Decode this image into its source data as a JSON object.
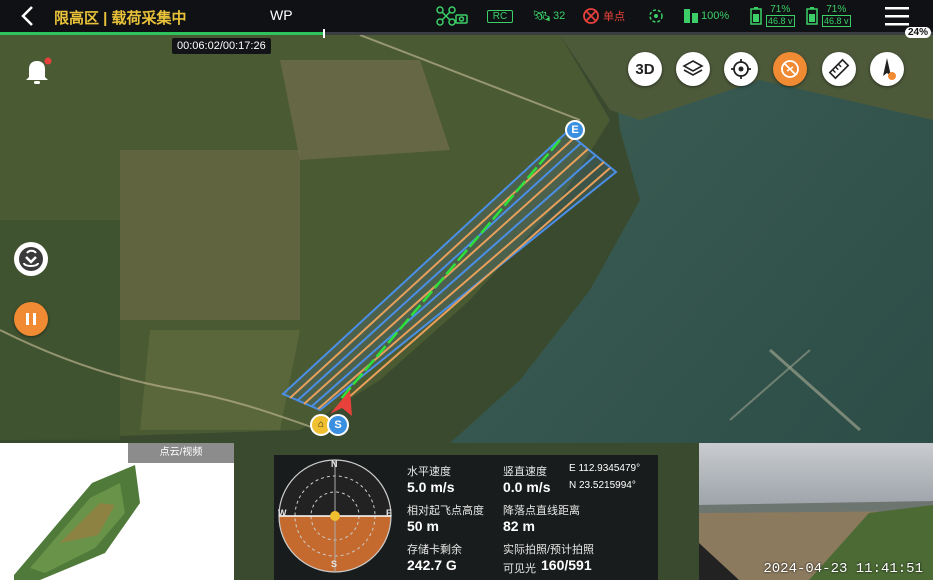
{
  "header": {
    "title": "限高区 | 载荷采集中",
    "mode": "WP",
    "status": {
      "rc_label": "RC",
      "satellites": "32",
      "positioning": "单点",
      "drone_battery": "100%",
      "battery1_pct": "71%",
      "battery1_volt": "46.8 v",
      "battery2_pct": "71%",
      "battery2_volt": "46.8 v"
    },
    "corner_pct": "24%"
  },
  "mission": {
    "elapsed_total": "00:06:02/00:17:26",
    "progress": 0.346
  },
  "map": {
    "buttons": [
      "3D",
      "layers",
      "locate",
      "no-fly",
      "measure",
      "compass"
    ],
    "start_marker": "S",
    "end_marker": "E"
  },
  "left_panel": {
    "tab_label": "点云/视频"
  },
  "telemetry": {
    "h_speed_label": "水平速度",
    "h_speed": "5.0 m/s",
    "v_speed_label": "竖直速度",
    "v_speed": "0.0 m/s",
    "longitude": "E 112.9345479°",
    "latitude": "N 23.5215994°",
    "alt_label": "相对起飞点高度",
    "alt": "50 m",
    "dist_label": "降落点直线距离",
    "dist": "82 m",
    "storage_label": "存储卡剩余",
    "storage": "242.7 G",
    "photo_label": "实际拍照/预计拍照",
    "photo_type": "可见光",
    "photos": "160/591",
    "radar_dirs": {
      "n": "N",
      "e": "E",
      "s": "S",
      "w": "W"
    }
  },
  "camera": {
    "timestamp": "2024-04-23 11:41:51"
  },
  "colors": {
    "accent_green": "#2fc35e",
    "title_yellow": "#e9c23a",
    "warning_red": "#e8413b",
    "orange": "#f08a33",
    "route_blue": "#4a8fe8",
    "route_done": "#2ee03a"
  }
}
